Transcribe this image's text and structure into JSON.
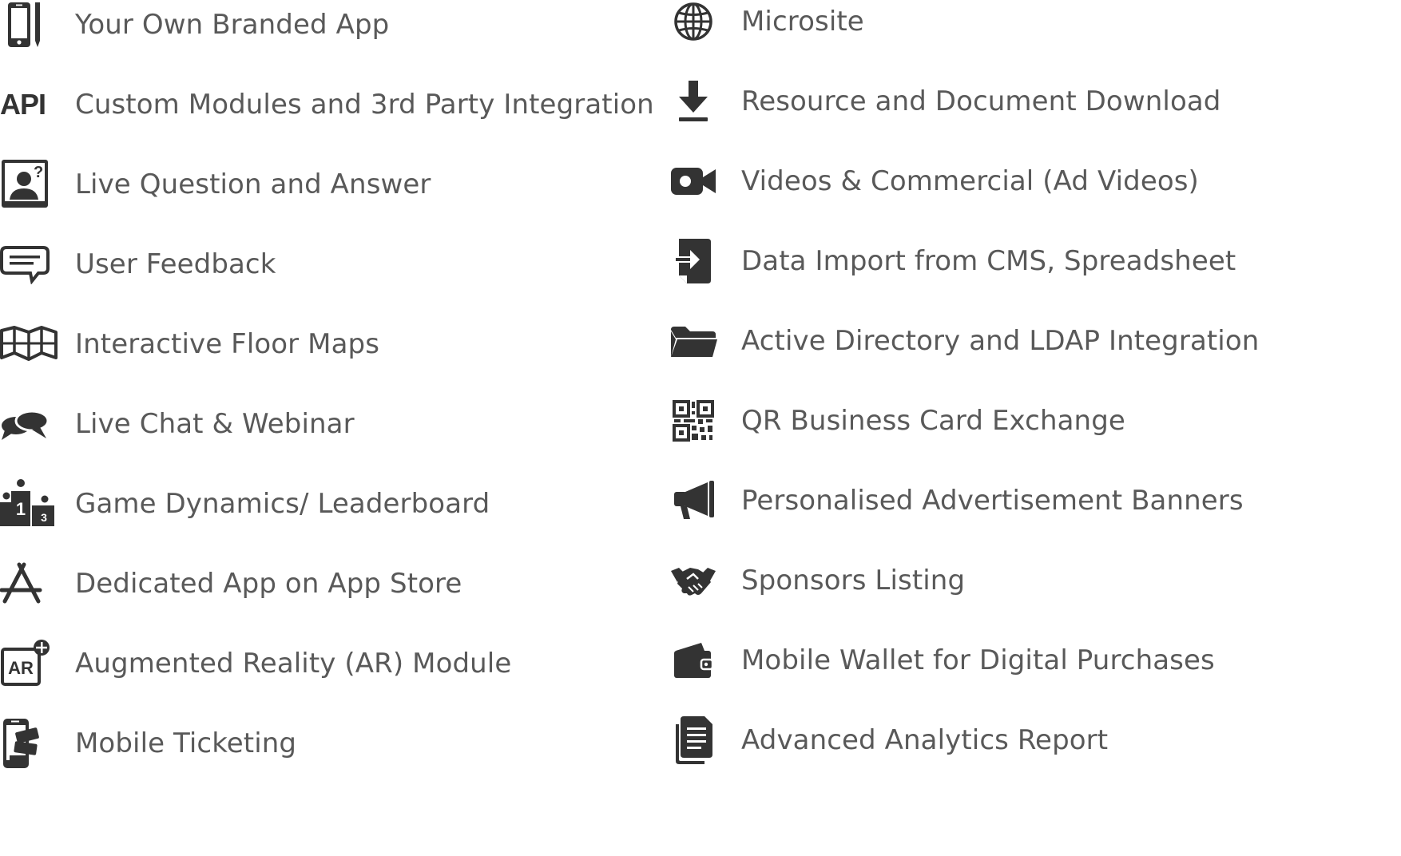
{
  "features": {
    "left": [
      {
        "label": "Your Own Branded App",
        "icon": "mobile-phone-icon"
      },
      {
        "label": "Custom Modules and 3rd Party Integration",
        "icon": "api-icon",
        "icon_text": "API"
      },
      {
        "label": "Live Question and Answer",
        "icon": "question-person-icon"
      },
      {
        "label": "User Feedback",
        "icon": "comment-icon"
      },
      {
        "label": "Interactive Floor Maps",
        "icon": "map-icon"
      },
      {
        "label": "Live Chat & Webinar",
        "icon": "chat-bubbles-icon"
      },
      {
        "label": "Game Dynamics/ Leaderboard",
        "icon": "podium-icon"
      },
      {
        "label": "Dedicated App on App Store",
        "icon": "app-store-icon"
      },
      {
        "label": "Augmented Reality (AR) Module",
        "icon": "ar-icon",
        "icon_text": "AR"
      },
      {
        "label": "Mobile Ticketing",
        "icon": "mobile-ticket-icon"
      }
    ],
    "right": [
      {
        "label": "Microsite",
        "icon": "globe-icon"
      },
      {
        "label": "Resource and Document Download",
        "icon": "download-icon"
      },
      {
        "label": "Videos & Commercial (Ad Videos)",
        "icon": "video-camera-icon"
      },
      {
        "label": "Data Import from CMS, Spreadsheet",
        "icon": "import-icon"
      },
      {
        "label": "Active Directory and LDAP Integration",
        "icon": "folder-icon"
      },
      {
        "label": "QR Business Card Exchange",
        "icon": "qr-code-icon"
      },
      {
        "label": "Personalised Advertisement Banners",
        "icon": "megaphone-icon"
      },
      {
        "label": "Sponsors Listing",
        "icon": "handshake-icon"
      },
      {
        "label": "Mobile Wallet for Digital Purchases",
        "icon": "wallet-icon"
      },
      {
        "label": "Advanced Analytics Report",
        "icon": "document-icon"
      }
    ]
  },
  "colors": {
    "icon": "#333333",
    "text": "#595959",
    "background": "#ffffff"
  }
}
